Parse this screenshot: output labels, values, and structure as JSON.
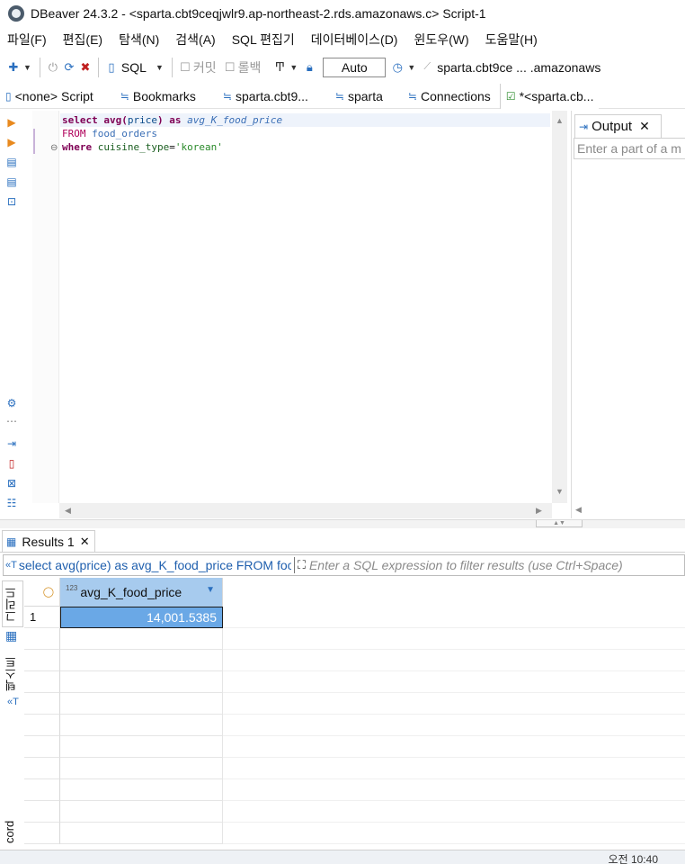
{
  "window": {
    "title": "DBeaver 24.3.2 - <sparta.cbt9ceqjwlr9.ap-northeast-2.rds.amazonaws.c> Script-1"
  },
  "menu": [
    "파일(F)",
    "편집(E)",
    "탐색(N)",
    "검색(A)",
    "SQL 편집기",
    "데이터베이스(D)",
    "윈도우(W)",
    "도움말(H)"
  ],
  "toolbar": {
    "sql_label": "SQL",
    "commit_label": "커밋",
    "rollback_label": "롤백",
    "transaction_mode": "Auto",
    "connection_label": "sparta.cbt9ce ... .amazonaws"
  },
  "tabs": [
    {
      "label": "<none> Script"
    },
    {
      "label": "Bookmarks"
    },
    {
      "label": "sparta.cbt9..."
    },
    {
      "label": "sparta"
    },
    {
      "label": "Connections"
    },
    {
      "label": "*<sparta.cb..."
    }
  ],
  "editor": {
    "lines": [
      {
        "kw1": "select",
        "fn": "avg(",
        "col": "price",
        "close": ")",
        "kw2": "as",
        "alias": "avg_K_food_price"
      },
      {
        "kw": "FROM",
        "table": "food_orders"
      },
      {
        "kw": "where",
        "col": "cuisine_type",
        "eq": "=",
        "str": "'korean'"
      }
    ]
  },
  "output": {
    "tab_label": "Output",
    "filter_placeholder": "Enter a part of a m"
  },
  "results": {
    "tab_label": "Results 1",
    "query_text": "select avg(price) as avg_K_food_price FROM food_orders",
    "filter_placeholder": "Enter a SQL expression to filter results (use Ctrl+Space)",
    "side_tabs": [
      "그리드",
      "텍스트",
      "cord"
    ],
    "columns": [
      {
        "type_label": "123",
        "name": "avg_K_food_price"
      }
    ],
    "rows": [
      {
        "row_number": "1",
        "value": "14,001.5385"
      }
    ]
  },
  "taskbar": {
    "clock": "오전 10:40"
  }
}
